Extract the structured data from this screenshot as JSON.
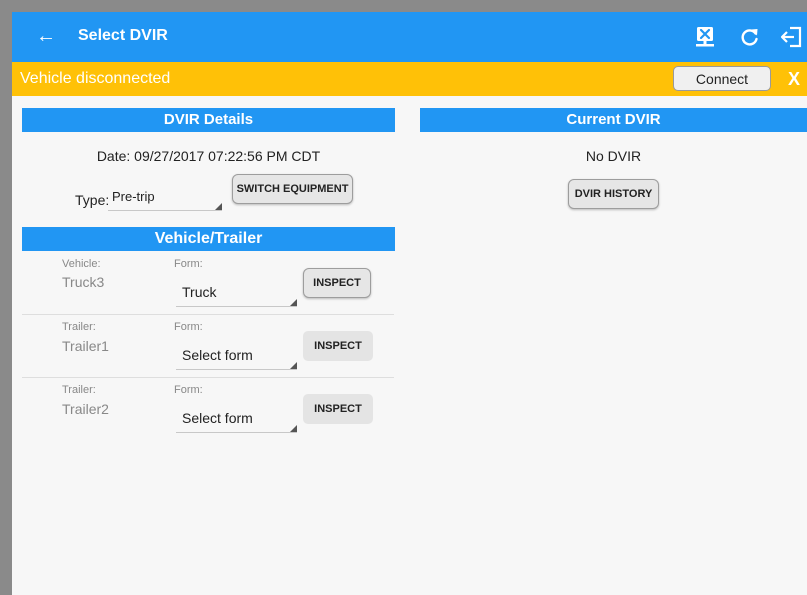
{
  "header": {
    "title": "Select DVIR",
    "back_icon": "←",
    "actions": [
      {
        "name": "sync-icon"
      },
      {
        "name": "refresh-icon"
      },
      {
        "name": "logout-icon"
      }
    ]
  },
  "banner": {
    "text": "Vehicle disconnected",
    "connect_label": "Connect",
    "close_label": "X"
  },
  "dvir_details": {
    "heading": "DVIR Details",
    "date": "Date: 09/27/2017 07:22:56 PM CDT",
    "type_label": "Type:",
    "type_value": "Pre-trip",
    "switch_label": "SWITCH EQUIPMENT"
  },
  "current_dvir": {
    "heading": "Current DVIR",
    "status": "No DVIR",
    "history_label": "DVIR HISTORY"
  },
  "vehicle_trailer": {
    "heading": "Vehicle/Trailer",
    "rows": [
      {
        "kind_label": "Vehicle:",
        "name": "Truck3",
        "form_label": "Form:",
        "form_value": "Truck",
        "inspect_label": "INSPECT"
      },
      {
        "kind_label": "Trailer:",
        "name": "Trailer1",
        "form_label": "Form:",
        "form_value": "Select form",
        "inspect_label": "INSPECT"
      },
      {
        "kind_label": "Trailer:",
        "name": "Trailer2",
        "form_label": "Form:",
        "form_value": "Select form",
        "inspect_label": "INSPECT"
      }
    ]
  },
  "colors": {
    "primary": "#2196F3",
    "warning": "#FFC107"
  }
}
